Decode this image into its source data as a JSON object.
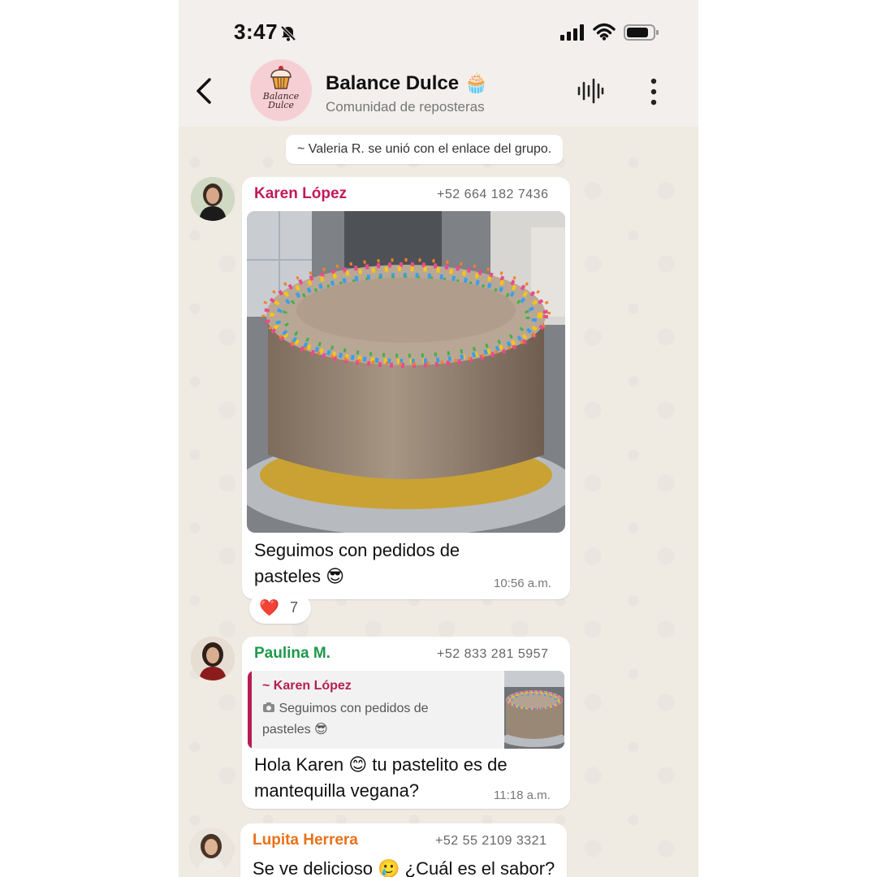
{
  "status": {
    "time": "3:47"
  },
  "chat": {
    "name": "Balance Dulce",
    "name_emoji": "🧁",
    "subtitle": "Comunidad de reposteras",
    "logo_text_1": "Balance",
    "logo_text_2": "Dulce"
  },
  "system_message": "~ Valeria R. se unió con el enlace del grupo.",
  "messages": [
    {
      "sender": "Karen López",
      "sender_color": "#c2185b",
      "phone": "+52 664 182 7436",
      "text_line1": "Seguimos con pedidos de",
      "text_line2": "pasteles",
      "emoji": "😎",
      "time": "10:56 a.m.",
      "reaction_emoji": "❤️",
      "reaction_count": "7"
    },
    {
      "sender": "Paulina M.",
      "sender_color": "#1e9a4a",
      "phone": "+52 833 281 5957",
      "quote_sender": "~ Karen López",
      "quote_text_line1": "Seguimos con pedidos de",
      "quote_text_line2": "pasteles",
      "quote_emoji": "😎",
      "text_line1a": "Hola Karen",
      "text_emoji": "😊",
      "text_line1b": "tu pastelito es de",
      "text_line2": "mantequilla vegana?",
      "time": "11:18 a.m."
    },
    {
      "sender": "Lupita Herrera",
      "sender_color": "#e8711a",
      "phone": "+52 55 2109 3321",
      "text_a": "Se ve delicioso",
      "emoji": "🥲",
      "text_b": "¿Cuál es el sabor?"
    }
  ]
}
